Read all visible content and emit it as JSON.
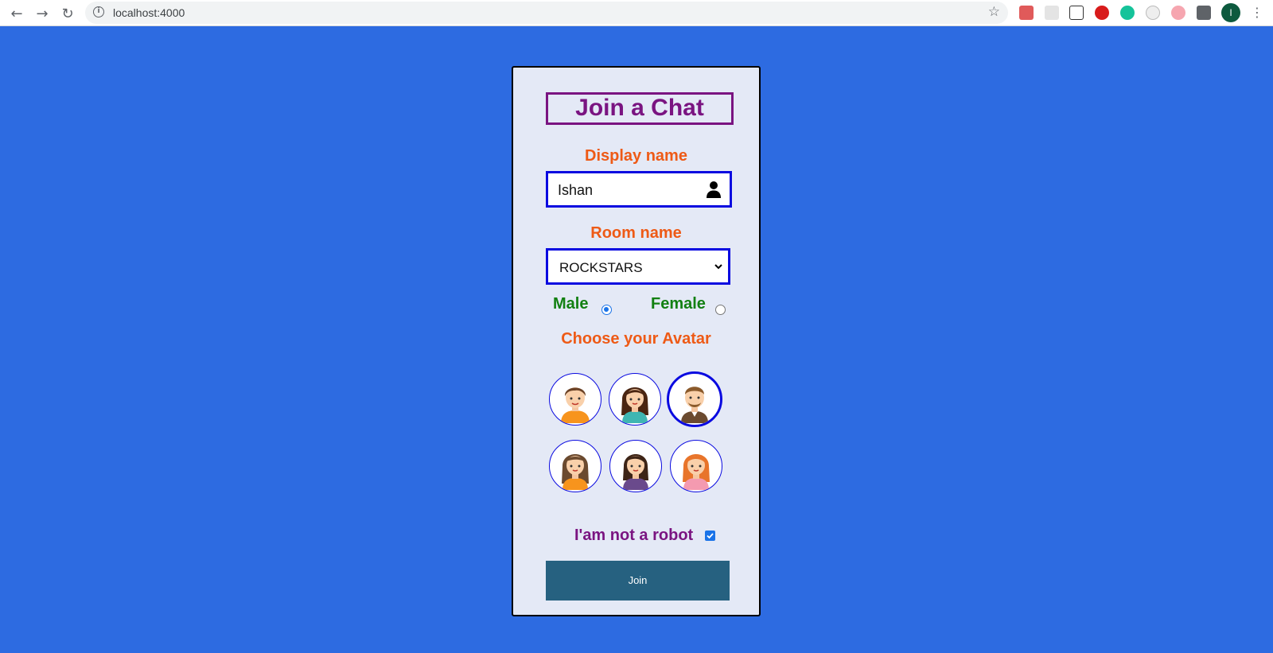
{
  "browser": {
    "url": "localhost:4000",
    "profile_initial": "I"
  },
  "form": {
    "title": "Join a Chat",
    "display_name_label": "Display name",
    "display_name_value": "Ishan",
    "room_name_label": "Room name",
    "room_selected": "ROCKSTARS",
    "gender_options": [
      {
        "label": "Male",
        "selected": true
      },
      {
        "label": "Female",
        "selected": false
      }
    ],
    "avatar_label": "Choose your Avatar",
    "avatars": [
      {
        "name": "boy-brown-hair",
        "selected": false
      },
      {
        "name": "girl-dark-hair",
        "selected": false
      },
      {
        "name": "man-beard",
        "selected": true
      },
      {
        "name": "girl-long-brown-hair",
        "selected": false
      },
      {
        "name": "girl-purple-top",
        "selected": false
      },
      {
        "name": "girl-red-hair",
        "selected": false
      }
    ],
    "robot_label": "I'am not a robot",
    "robot_checked": true,
    "join_label": "Join"
  },
  "colors": {
    "background": "#2d6be1",
    "card": "#e4e9f6",
    "title": "#7a1481",
    "label": "#ee5a16",
    "gender": "#128012",
    "input_border": "#0a0ae0",
    "join_button": "#266180"
  }
}
